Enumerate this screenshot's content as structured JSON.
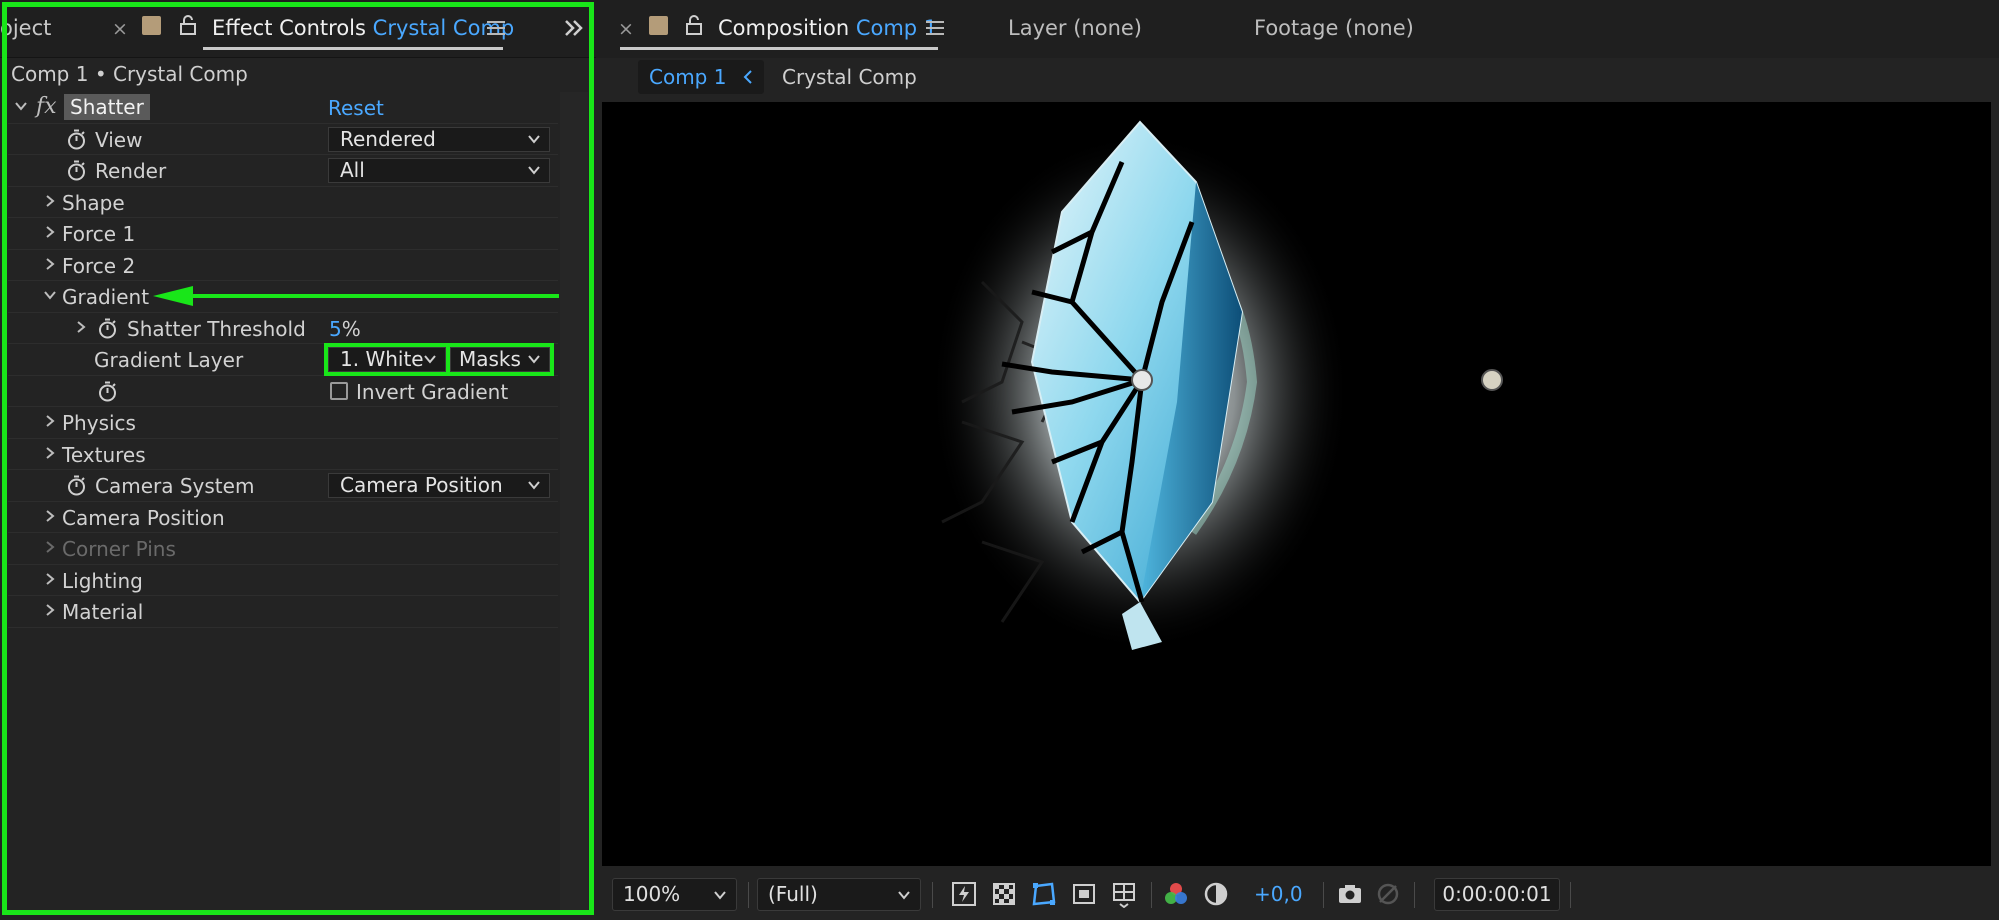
{
  "left_panel": {
    "project_tab_label": "oject",
    "tab_prefix": "Effect Controls",
    "tab_comp": "Crystal Comp",
    "comp_path": "Comp 1 • Crystal Comp"
  },
  "effect": {
    "fx_symbol": "fx",
    "name": "Shatter",
    "reset_label": "Reset",
    "view_label": "View",
    "view_value": "Rendered",
    "render_label": "Render",
    "render_value": "All",
    "shape_label": "Shape",
    "force1_label": "Force 1",
    "force2_label": "Force 2",
    "gradient_label": "Gradient",
    "shatter_threshold_label": "Shatter Threshold",
    "shatter_threshold_number": "5",
    "shatter_threshold_unit": "%",
    "gradient_layer_label": "Gradient Layer",
    "gradient_layer_value": "1. White",
    "gradient_layer_mode": "Masks",
    "invert_gradient_label": "Invert Gradient",
    "physics_label": "Physics",
    "textures_label": "Textures",
    "camera_system_label": "Camera System",
    "camera_system_value": "Camera Position",
    "camera_position_label": "Camera Position",
    "corner_pins_label": "Corner Pins",
    "lighting_label": "Lighting",
    "material_label": "Material"
  },
  "right_panel": {
    "tab_prefix": "Composition",
    "tab_comp": "Comp 1",
    "layer_tab": "Layer (none)",
    "footage_tab": "Footage (none)",
    "breadcrumb_active": "Comp 1",
    "breadcrumb_next": "Crystal Comp"
  },
  "footer": {
    "zoom": "100%",
    "resolution": "(Full)",
    "exposure": "+0,0",
    "timecode": "0:00:00:01"
  },
  "colors": {
    "accent": "#4aa8ff",
    "highlight": "#19e619",
    "panel_bg": "#232323",
    "viewer_bg": "#000000"
  }
}
